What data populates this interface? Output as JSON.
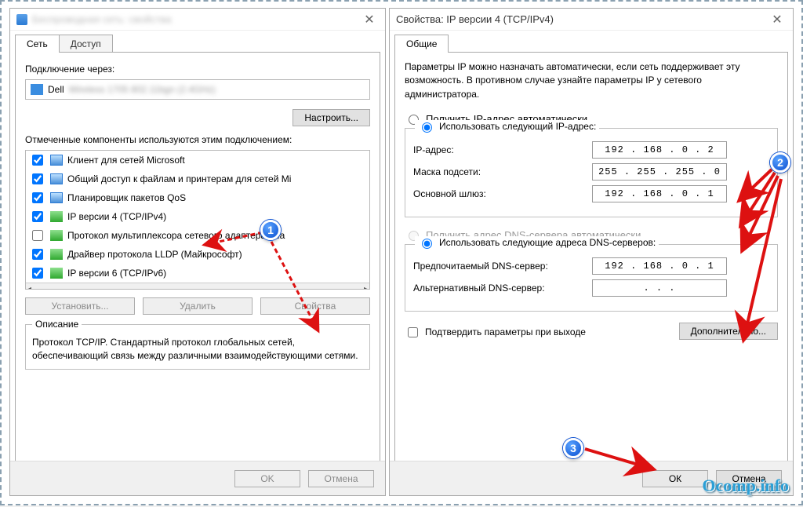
{
  "left": {
    "title_blurred": "Беспроводная сеть: свойства",
    "tabs": {
      "tab1": "Сеть",
      "tab2": "Доступ"
    },
    "connect_label": "Подключение через:",
    "adapter_prefix": "Dell",
    "adapter_blur": "Wireless 1705 802.11bgn (2.4GHz)",
    "configure_btn": "Настроить...",
    "components_label": "Отмеченные компоненты используются этим подключением:",
    "items": [
      {
        "checked": true,
        "icon": "icn-mon",
        "label": "Клиент для сетей Microsoft"
      },
      {
        "checked": true,
        "icon": "icn-mon",
        "label": "Общий доступ к файлам и принтерам для сетей Mi"
      },
      {
        "checked": true,
        "icon": "icn-mon",
        "label": "Планировщик пакетов QoS"
      },
      {
        "checked": true,
        "icon": "icn-green",
        "label": "IP версии 4 (TCP/IPv4)"
      },
      {
        "checked": false,
        "icon": "icn-green",
        "label": "Протокол мультиплексора сетевого адаптера (Ма"
      },
      {
        "checked": true,
        "icon": "icn-green",
        "label": "Драйвер протокола LLDP (Майкрософт)"
      },
      {
        "checked": true,
        "icon": "icn-green",
        "label": "IP версии 6 (TCP/IPv6)"
      }
    ],
    "install_btn": "Установить...",
    "remove_btn": "Удалить",
    "props_btn": "Свойства",
    "desc_legend": "Описание",
    "desc_text": "Протокол TCP/IP. Стандартный протокол глобальных сетей, обеспечивающий связь между различными взаимодействующими сетями.",
    "ok": "OK",
    "cancel": "Отмена"
  },
  "right": {
    "title": "Свойства: IP версии 4 (TCP/IPv4)",
    "tab": "Общие",
    "para": "Параметры IP можно назначать автоматически, если сеть поддерживает эту возможность. В противном случае узнайте параметры IP у сетевого администратора.",
    "radio_auto_ip": "Получить IP-адрес автоматически",
    "radio_use_ip": "Использовать следующий IP-адрес:",
    "ip_label": "IP-адрес:",
    "ip_value": "192 . 168 .  0  .  2",
    "mask_label": "Маска подсети:",
    "mask_value": "255 . 255 . 255 .  0",
    "gw_label": "Основной шлюз:",
    "gw_value": "192 . 168 .  0  .  1",
    "radio_auto_dns": "Получить адрес DNS-сервера автоматически",
    "radio_use_dns": "Использовать следующие адреса DNS-серверов:",
    "dns1_label": "Предпочитаемый DNS-сервер:",
    "dns1_value": "192 . 168 .  0  .  1",
    "dns2_label": "Альтернативный DNS-сервер:",
    "dns2_value": ".       .       .",
    "validate_label": "Подтвердить параметры при выходе",
    "advanced_btn": "Дополнительно...",
    "ok": "ОК",
    "cancel": "Отмена"
  },
  "watermark": "Ocomp.info"
}
